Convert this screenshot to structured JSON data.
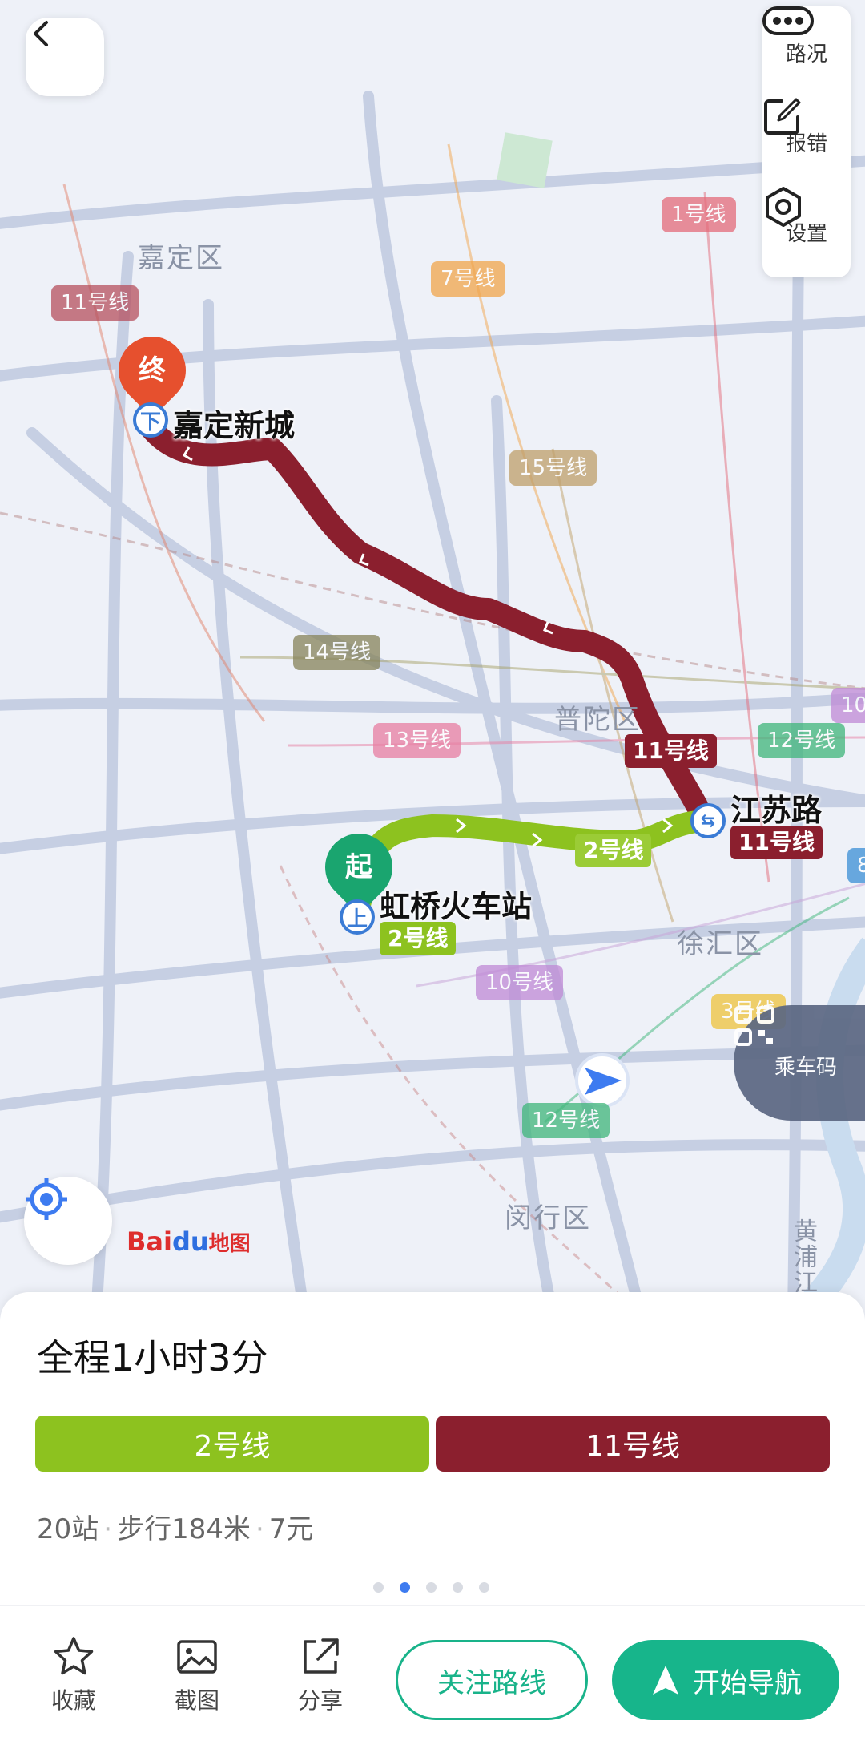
{
  "map": {
    "districts": [
      "嘉定区",
      "普陀区",
      "徐汇区",
      "闵行区",
      "黄浦江"
    ],
    "line_tags": [
      "1号线",
      "7号线",
      "11号线",
      "15号线",
      "14号线",
      "13号线",
      "12号线",
      "10号线",
      "3号线",
      "12号线",
      "10",
      "8"
    ],
    "start_pin": "起",
    "end_pin": "终",
    "start_station": "虹桥火车站",
    "start_station_line": "2号线",
    "end_station": "嘉定新城",
    "transfer_station": "江苏路",
    "transfer_line": "11号线",
    "route_tag_line2": "2号线",
    "route_tag_line11": "11号线",
    "start_icon": "上",
    "end_icon": "下",
    "baidu_logo_a": "Bai",
    "baidu_logo_b": "du",
    "baidu_logo_c": "地图",
    "colors": {
      "line2": "#8dc21f",
      "line11": "#8b1f2e",
      "start": "#1aa56f",
      "end": "#e6502e"
    }
  },
  "toolbar": {
    "traffic_label": "路况",
    "report_label": "报错",
    "settings_label": "设置"
  },
  "ride_code_label": "乘车码",
  "route": {
    "total_time": "全程1小时3分",
    "segments": [
      {
        "label": "2号线",
        "color": "#8dc21f"
      },
      {
        "label": "11号线",
        "color": "#8b1f2e"
      }
    ],
    "stops": "20站",
    "walk": "步行184米",
    "fare": "7元",
    "page_count": 5,
    "page_active": 2
  },
  "bottom_bar": {
    "favorite_label": "收藏",
    "screenshot_label": "截图",
    "share_label": "分享",
    "follow_label": "关注路线",
    "navigate_label": "开始导航"
  }
}
